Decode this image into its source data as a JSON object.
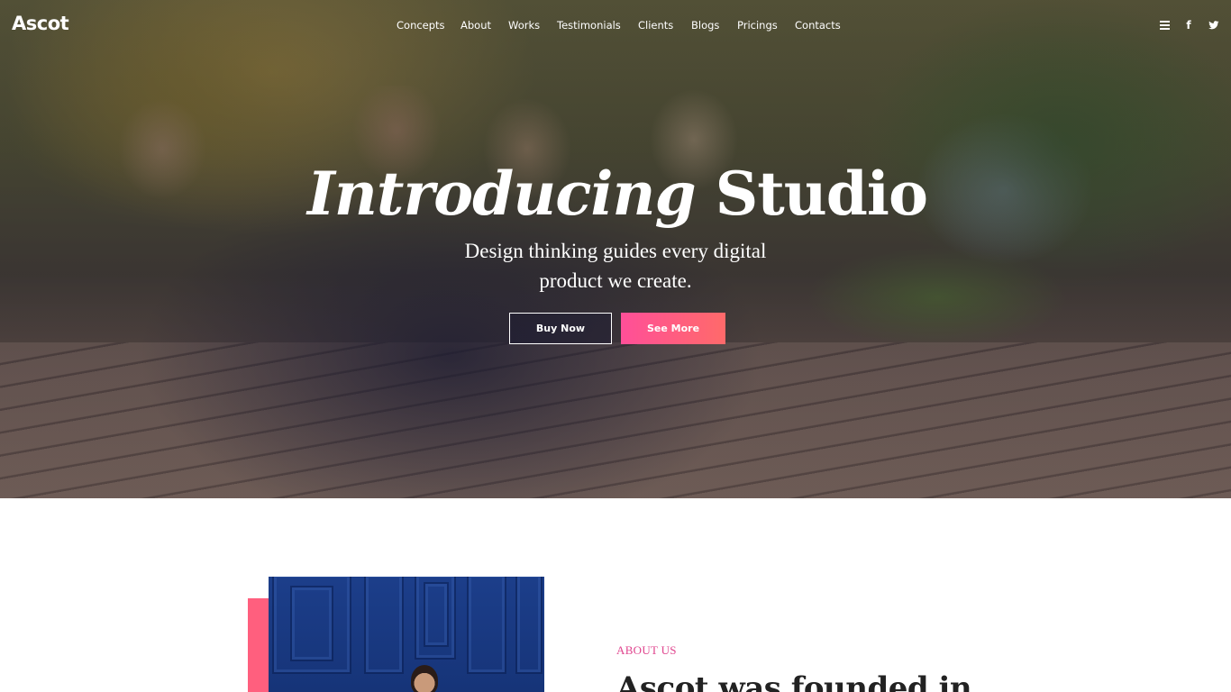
{
  "brand": {
    "logo_text": "Ascot"
  },
  "nav": {
    "items": [
      {
        "label": "Concepts"
      },
      {
        "label": "About"
      },
      {
        "label": "Works"
      },
      {
        "label": "Testimonials"
      },
      {
        "label": "Clients"
      },
      {
        "label": "Blogs"
      },
      {
        "label": "Pricings"
      },
      {
        "label": "Contacts"
      }
    ],
    "right_icons": [
      "menu-icon",
      "facebook-icon",
      "twitter-icon"
    ],
    "facebook_glyph": "f"
  },
  "hero": {
    "title_italic": "Introducing",
    "title_regular": "Studio",
    "subtitle": "Design thinking guides every digital product we create.",
    "buttons": {
      "primary_label": "Buy Now",
      "secondary_label": "See More"
    }
  },
  "about": {
    "label": "ABOUT US",
    "heading": "Ascot was founded in"
  },
  "colors": {
    "accent_pink": "#ff5a8a",
    "label_pink": "#e0458e",
    "photo_blue": "#1c3e8a"
  }
}
